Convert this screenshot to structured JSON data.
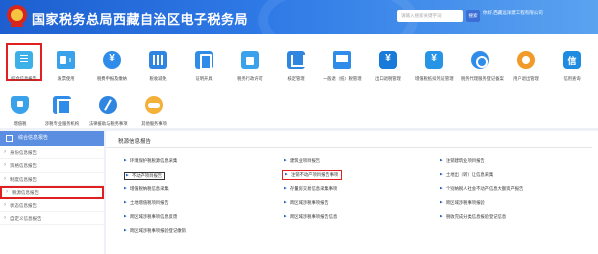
{
  "header": {
    "title": "国家税务总局西藏自治区电子税务局",
    "search_placeholder": "请输入搜索关键字词",
    "search_button": "搜索",
    "user_text": "你好,西藏远洋建工程有限公司"
  },
  "nav": {
    "items": [
      {
        "label": "综合信息报告",
        "icon": "doc-icon"
      },
      {
        "label": "发票使用",
        "icon": "card-icon"
      },
      {
        "label": "税费申报及缴纳",
        "icon": "tax-payment-icon"
      },
      {
        "label": "税收减免",
        "icon": "calculator-icon"
      },
      {
        "label": "证明开具",
        "icon": "clipboard-icon"
      },
      {
        "label": "税务行政许可",
        "icon": "bag-icon"
      },
      {
        "label": "核定管理",
        "icon": "house-icon"
      },
      {
        "label": "一般退（抵）税管理",
        "icon": "monitor-icon"
      },
      {
        "label": "出口退税管理",
        "icon": "yuan-badge-icon"
      },
      {
        "label": "增值税抵扣凭证管理",
        "icon": "yuan-badge2-icon"
      },
      {
        "label": "税务代理服务登记备案",
        "icon": "chart-icon"
      },
      {
        "label": "用户退出管理",
        "icon": "gear-icon"
      },
      {
        "label": "信用查询",
        "icon": "credit-icon"
      },
      {
        "label": "增值税",
        "icon": "shield-icon"
      },
      {
        "label": "涉税专业服务机构",
        "icon": "pdf-icon"
      },
      {
        "label": "法律援助与税务事项",
        "icon": "pen-icon"
      },
      {
        "label": "其他服务事项",
        "icon": "handshake-icon"
      }
    ]
  },
  "sidebar": {
    "title": "综合信息报告",
    "items": [
      "身份信息报告",
      "资格信息报告",
      "制度信息报告",
      "税源信息报告",
      "状态信息报告",
      "自定义信息报告"
    ]
  },
  "content": {
    "title": "税源信息报告",
    "links": [
      {
        "label": "环境保护税税源信息采集",
        "col": 0,
        "row": 0
      },
      {
        "label": "建筑业项目报告",
        "col": 1,
        "row": 0
      },
      {
        "label": "注销建筑业项目报告",
        "col": 2,
        "row": 0
      },
      {
        "label": "不动产项目报告",
        "col": 0,
        "row": 1
      },
      {
        "label": "注销不动产项目报告事项",
        "col": 1,
        "row": 1
      },
      {
        "label": "土地出（转）让信息采集",
        "col": 2,
        "row": 1
      },
      {
        "label": "增值税纳税信息采集",
        "col": 0,
        "row": 2
      },
      {
        "label": "存量房交易信息采集事项",
        "col": 1,
        "row": 2
      },
      {
        "label": "个别纳税人社会不动产信息大额资产报告",
        "col": 2,
        "row": 2
      },
      {
        "label": "土地增值税项目报告",
        "col": 0,
        "row": 3
      },
      {
        "label": "跨区域涉税事项报告",
        "col": 1,
        "row": 3
      },
      {
        "label": "跨区域涉税事项报验",
        "col": 2,
        "row": 3
      },
      {
        "label": "跨区域涉税事项信息反馈",
        "col": 0,
        "row": 4
      },
      {
        "label": "跨区域涉税事项报告信息",
        "col": 1,
        "row": 4
      },
      {
        "label": "税收完成分类信息报验登记信息",
        "col": 2,
        "row": 4
      },
      {
        "label": "跨区域涉税事项报验登记缴销",
        "col": 0,
        "row": 5
      }
    ]
  }
}
